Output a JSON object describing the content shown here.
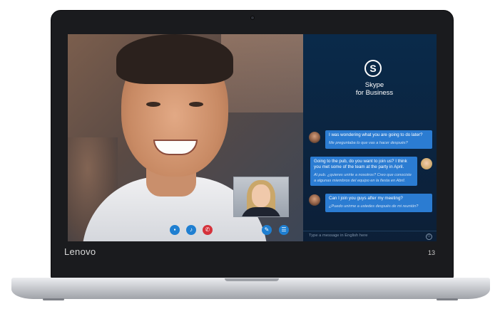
{
  "device": {
    "brand": "Lenovo",
    "model": "13"
  },
  "app": {
    "logo_letter": "S",
    "name_line1": "Skype",
    "name_line2": "for Business",
    "accent": "#2b7cd2"
  },
  "call_controls": [
    {
      "icon": "video-icon",
      "glyph": "▪"
    },
    {
      "icon": "microphone-icon",
      "glyph": "♪"
    },
    {
      "icon": "end-call-icon",
      "glyph": "✆"
    },
    {
      "icon": "chat-icon",
      "glyph": "✎"
    },
    {
      "icon": "options-icon",
      "glyph": "☰"
    }
  ],
  "messages": [
    {
      "text": "I was wondering what you are going to do later?",
      "translation": "Me preguntaba lo que vas a hacer después?"
    },
    {
      "text": "Going to the pub, do you want to join us? I think you met some of the team at the party in April.",
      "translation": "Al pub. ¿quieres unirte a nosotros? Creo que conociste a algunas miembros del equipo en la fiesta en Abril."
    },
    {
      "text": "Can I join you guys after my meeting?",
      "translation": "¿Puedo unirme a ustedes después de mi reunión?"
    }
  ],
  "input": {
    "placeholder": "Type a message in English here"
  }
}
